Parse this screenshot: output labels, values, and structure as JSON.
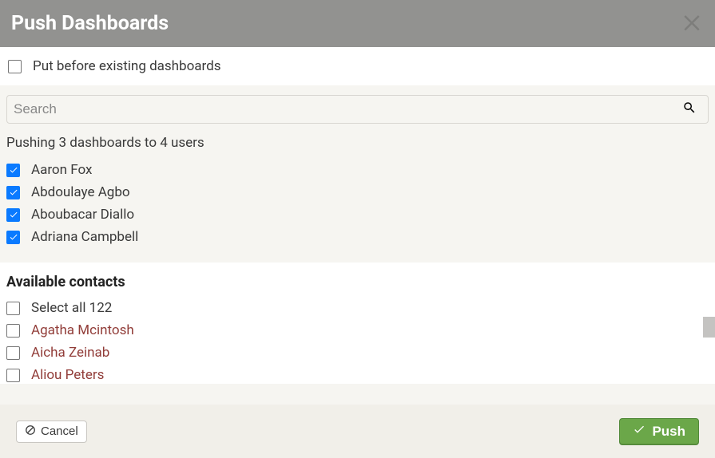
{
  "header": {
    "title": "Push Dashboards"
  },
  "options": {
    "put_before_label": "Put before existing dashboards",
    "put_before_checked": false
  },
  "search": {
    "placeholder": "Search",
    "value": ""
  },
  "status_text": "Pushing 3 dashboards to 4 users",
  "selected_users": [
    {
      "name": "Aaron Fox",
      "checked": true
    },
    {
      "name": "Abdoulaye Agbo",
      "checked": true
    },
    {
      "name": "Aboubacar Diallo",
      "checked": true
    },
    {
      "name": "Adriana Campbell",
      "checked": true
    }
  ],
  "available": {
    "heading": "Available contacts",
    "select_all_label": "Select all 122",
    "select_all_checked": false,
    "contacts": [
      {
        "name": "Agatha Mcintosh",
        "checked": false
      },
      {
        "name": "Aicha Zeinab",
        "checked": false
      },
      {
        "name": "Aliou Peters",
        "checked": false
      }
    ]
  },
  "footer": {
    "cancel_label": "Cancel",
    "push_label": "Push"
  }
}
